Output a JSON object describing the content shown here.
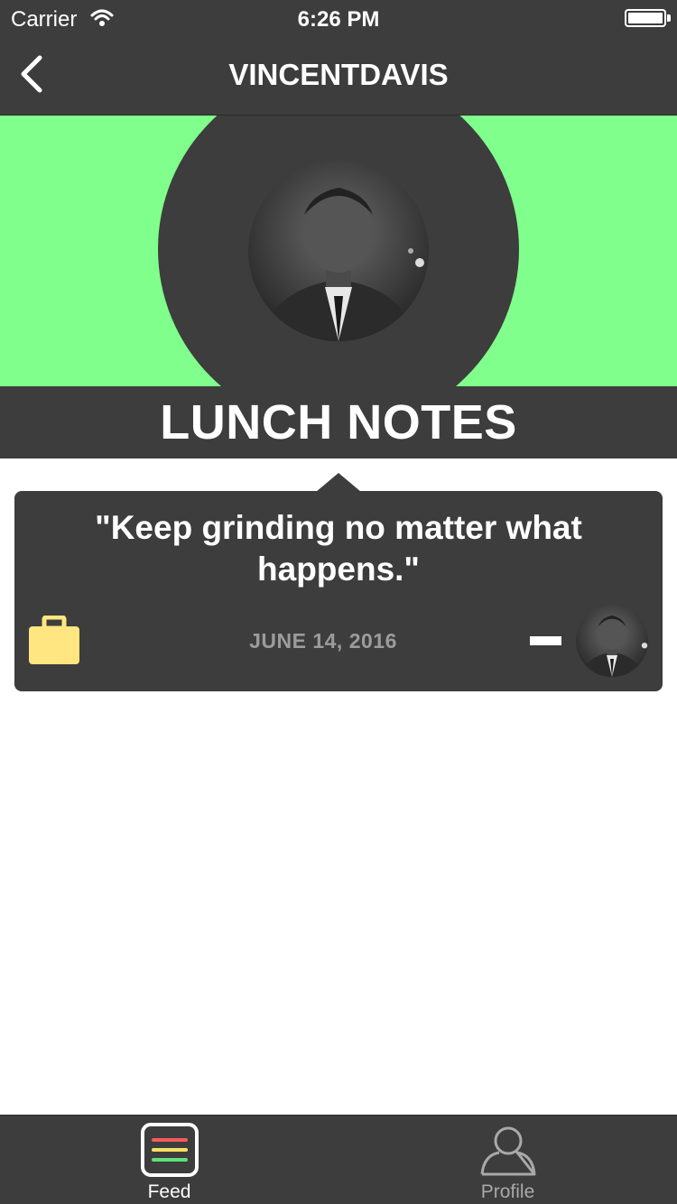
{
  "status_bar": {
    "carrier": "Carrier",
    "time": "6:26 PM",
    "icons": [
      "wifi-icon",
      "battery-icon"
    ]
  },
  "nav": {
    "title": "VINCENTDAVIS",
    "back_icon": "chevron-left-icon"
  },
  "header": {
    "section_title": "LUNCH NOTES",
    "banner_color": "#80ff8c"
  },
  "note": {
    "quote": "\"Keep grinding no matter what happens.\"",
    "date": "JUNE 14, 2016",
    "category_icon": "briefcase-icon",
    "category_color": "#ffe680",
    "action_icon": "minus-icon"
  },
  "tabs": [
    {
      "label": "Feed",
      "icon": "feed-icon",
      "selected": true
    },
    {
      "label": "Profile",
      "icon": "profile-icon",
      "selected": false
    }
  ],
  "colors": {
    "bar_background": "#3d3d3d",
    "accent_green": "#80ff8c",
    "feed_red": "#f45c5c",
    "feed_yellow": "#f7e064",
    "feed_green": "#5ee07a"
  }
}
